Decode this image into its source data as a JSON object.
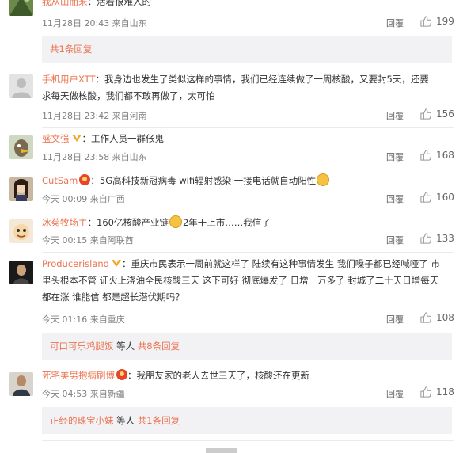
{
  "labels": {
    "reply": "回覆"
  },
  "comments": [
    {
      "user": "我从山而来",
      "text": "活着很难人的",
      "time": "11月28日 20:43 来自山东",
      "likes": "199",
      "replies_box": {
        "text": "共1条回复"
      }
    },
    {
      "user": "手机用户XTT",
      "text1": "我身边也发生了类似这样的事情，我们已经连续做了一周核酸，又要封5天，还要",
      "text2": "求每天做核酸，我们都不敢再做了，太可怕",
      "time": "11月28日 23:42 来自河南",
      "likes": "156"
    },
    {
      "user": "盛文强",
      "text": "工作人员一群伥鬼",
      "time": "11月28日 23:58 来自山东",
      "likes": "168"
    },
    {
      "user": "CutSam",
      "text": "5G高科技新冠病毒 wifi辐射感染 一接电话就自动阳性",
      "time": "今天 00:09 来自广西",
      "likes": "160"
    },
    {
      "user": "冰菊牧场主",
      "text_a": "160亿核酸产业链",
      "text_b": "2年干上市……我信了",
      "time": "今天 00:15 来自阿联酋",
      "likes": "133"
    },
    {
      "user": "Producerisland",
      "text1": "重庆市民表示一周前就这样了 陆续有这种事情发生 我们嗓子都已经喊哑了 市",
      "text2": "里头根本不管 证火上浇油全民核酸三天 这下可好 彻底爆发了 日增一万多了 封城了二十天日增每天",
      "text3": "都在涨 谁能信 都是超长潜伏期吗？",
      "time": "今天 01:16 来自重庆",
      "likes": "108",
      "replies_box": {
        "who": "可口可乐鸡腿饭",
        "mid": "等人",
        "count": "共8条回复"
      }
    },
    {
      "user": "死宅美男抱病刷博",
      "text": "我朋友家的老人去世三天了，核酸还在更新",
      "time": "今天 04:53 来自新疆",
      "likes": "118",
      "replies_box": {
        "who": "正经的珠宝小妹",
        "mid": "等人",
        "count": "共1条回复"
      }
    }
  ],
  "colors": {
    "accent": "#eb7350",
    "meta": "#808080",
    "reply_bg": "#f2f2f5"
  },
  "icons": [
    "thumb-up-icon",
    "vip-crown-icon",
    "emoji-face-icon",
    "avatar"
  ]
}
